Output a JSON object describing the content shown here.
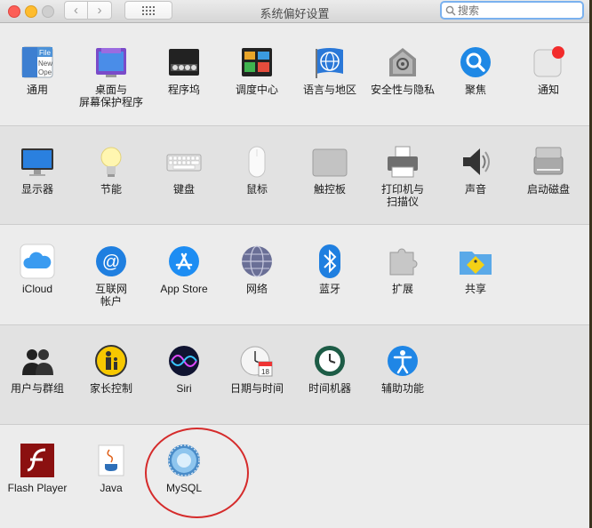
{
  "window": {
    "title": "系统偏好设置",
    "search_placeholder": "搜索"
  },
  "rows": [
    [
      {
        "id": "general",
        "label": "通用",
        "icon": "general-icon"
      },
      {
        "id": "desktop",
        "label": "桌面与\n屏幕保护程序",
        "icon": "desktop-screensaver-icon"
      },
      {
        "id": "dock",
        "label": "程序坞",
        "icon": "dock-icon"
      },
      {
        "id": "mission",
        "label": "调度中心",
        "icon": "mission-control-icon"
      },
      {
        "id": "language",
        "label": "语言与地区",
        "icon": "language-region-icon"
      },
      {
        "id": "security",
        "label": "安全性与隐私",
        "icon": "security-privacy-icon"
      },
      {
        "id": "spotlight",
        "label": "聚焦",
        "icon": "spotlight-icon"
      },
      {
        "id": "notifications",
        "label": "通知",
        "icon": "notifications-icon"
      }
    ],
    [
      {
        "id": "displays",
        "label": "显示器",
        "icon": "displays-icon"
      },
      {
        "id": "energy",
        "label": "节能",
        "icon": "energy-saver-icon"
      },
      {
        "id": "keyboard",
        "label": "键盘",
        "icon": "keyboard-icon"
      },
      {
        "id": "mouse",
        "label": "鼠标",
        "icon": "mouse-icon"
      },
      {
        "id": "trackpad",
        "label": "触控板",
        "icon": "trackpad-icon"
      },
      {
        "id": "printers",
        "label": "打印机与\n扫描仪",
        "icon": "printer-icon"
      },
      {
        "id": "sound",
        "label": "声音",
        "icon": "sound-icon"
      },
      {
        "id": "startup",
        "label": "启动磁盘",
        "icon": "startup-disk-icon"
      }
    ],
    [
      {
        "id": "icloud",
        "label": "iCloud",
        "icon": "icloud-icon"
      },
      {
        "id": "internet",
        "label": "互联网\n帐户",
        "icon": "internet-accounts-icon"
      },
      {
        "id": "appstore",
        "label": "App Store",
        "icon": "app-store-icon"
      },
      {
        "id": "network",
        "label": "网络",
        "icon": "network-icon"
      },
      {
        "id": "bluetooth",
        "label": "蓝牙",
        "icon": "bluetooth-icon"
      },
      {
        "id": "extensions",
        "label": "扩展",
        "icon": "extensions-icon"
      },
      {
        "id": "sharing",
        "label": "共享",
        "icon": "sharing-icon"
      }
    ],
    [
      {
        "id": "users",
        "label": "用户与群组",
        "icon": "users-groups-icon"
      },
      {
        "id": "parental",
        "label": "家长控制",
        "icon": "parental-controls-icon"
      },
      {
        "id": "siri",
        "label": "Siri",
        "icon": "siri-icon"
      },
      {
        "id": "datetime",
        "label": "日期与时间",
        "icon": "date-time-icon"
      },
      {
        "id": "timemachine",
        "label": "时间机器",
        "icon": "time-machine-icon"
      },
      {
        "id": "accessibility",
        "label": "辅助功能",
        "icon": "accessibility-icon"
      }
    ],
    [
      {
        "id": "flash",
        "label": "Flash Player",
        "icon": "flash-player-icon"
      },
      {
        "id": "java",
        "label": "Java",
        "icon": "java-icon"
      },
      {
        "id": "mysql",
        "label": "MySQL",
        "icon": "mysql-icon"
      }
    ]
  ],
  "colors": {
    "highlight_ring": "#d52b2b",
    "accent": "#1f7ff0"
  }
}
